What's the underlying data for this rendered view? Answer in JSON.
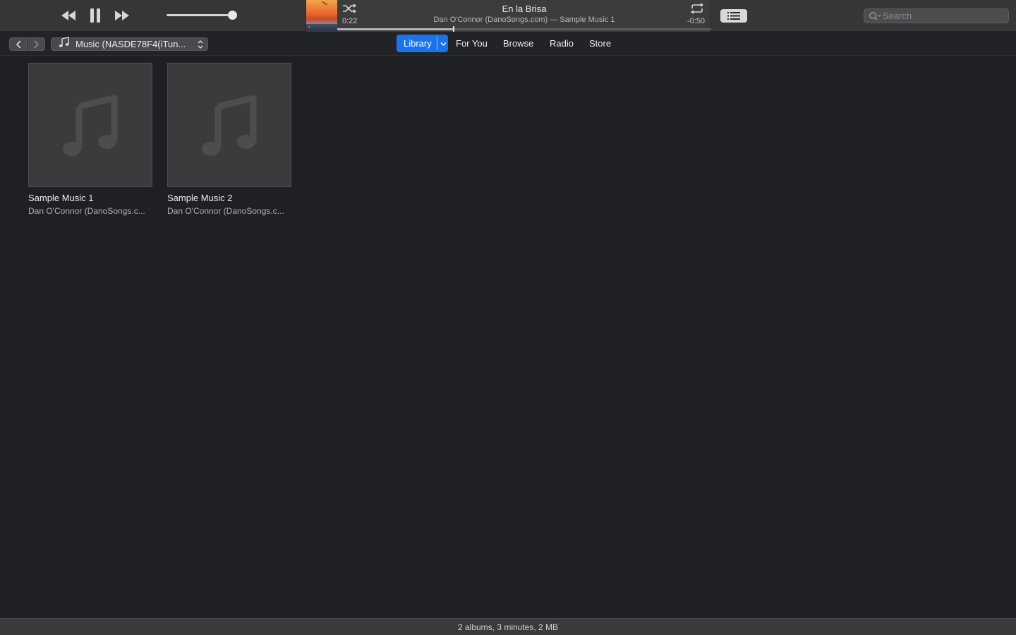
{
  "player": {
    "song_title": "En la Brisa",
    "song_subtitle": "Dan O'Connor (DanoSongs.com) — Sample Music 1",
    "elapsed": "0:22",
    "remaining": "-0:50",
    "progress_fraction": 0.31,
    "volume_fraction": 0.95
  },
  "search": {
    "placeholder": "Search"
  },
  "nav": {
    "source_label": "Music (NASDE78F4(iTun...",
    "tabs": [
      {
        "label": "Library"
      },
      {
        "label": "For You"
      },
      {
        "label": "Browse"
      },
      {
        "label": "Radio"
      },
      {
        "label": "Store"
      }
    ]
  },
  "albums": [
    {
      "name": "Sample Music 1",
      "artist": "Dan O'Connor (DanoSongs.c..."
    },
    {
      "name": "Sample Music 2",
      "artist": "Dan O'Connor (DanoSongs.c..."
    }
  ],
  "status": {
    "summary": "2 albums, 3 minutes, 2 MB"
  },
  "colors": {
    "accent": "#1a73e8",
    "background": "#1f2023",
    "toolbar": "#363638"
  }
}
